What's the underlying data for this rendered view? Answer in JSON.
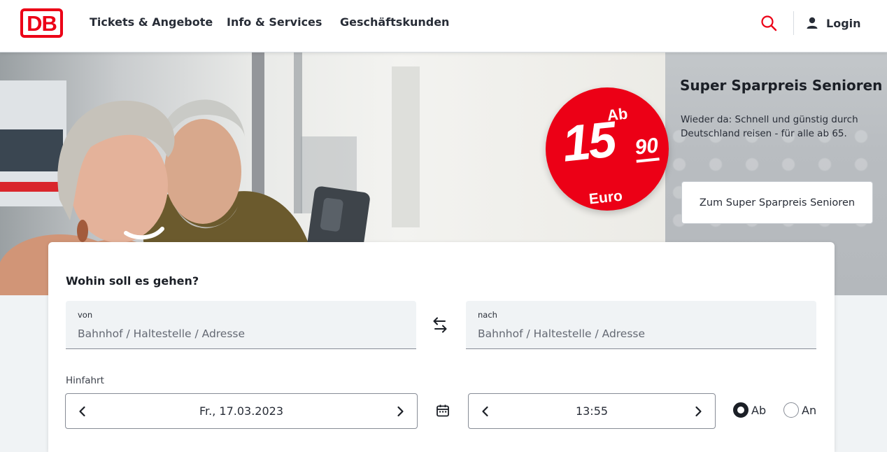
{
  "header": {
    "logo_text": "DB",
    "nav": [
      {
        "label": "Tickets & Angebote"
      },
      {
        "label": "Info & Services"
      },
      {
        "label": "Geschäftskunden"
      }
    ],
    "login_label": "Login",
    "icons": {
      "search": "search-icon",
      "user": "user-icon"
    }
  },
  "hero": {
    "badge": {
      "prefix": "Ab",
      "price_main": "15",
      "price_cents": "90",
      "currency": "Euro"
    },
    "promo": {
      "title": "Super Sparpreis Senioren",
      "text": "Wieder da: Schnell und günstig durch Deutschland reisen - für alle ab 65.",
      "button_label": "Zum Super Sparpreis Senioren"
    }
  },
  "search": {
    "title": "Wohin soll es gehen?",
    "from": {
      "label": "von",
      "placeholder": "Bahnhof / Haltestelle / Adresse",
      "value": ""
    },
    "to": {
      "label": "nach",
      "placeholder": "Bahnhof / Haltestelle / Adresse",
      "value": ""
    },
    "trip_label": "Hinfahrt",
    "date": "Fr., 17.03.2023",
    "time": "13:55",
    "mode_options": [
      {
        "label": "Ab",
        "selected": true
      },
      {
        "label": "An",
        "selected": false
      }
    ]
  },
  "colors": {
    "brand_red": "#ec0016",
    "text_dark": "#282d37",
    "field_bg": "#f0f3f5"
  }
}
